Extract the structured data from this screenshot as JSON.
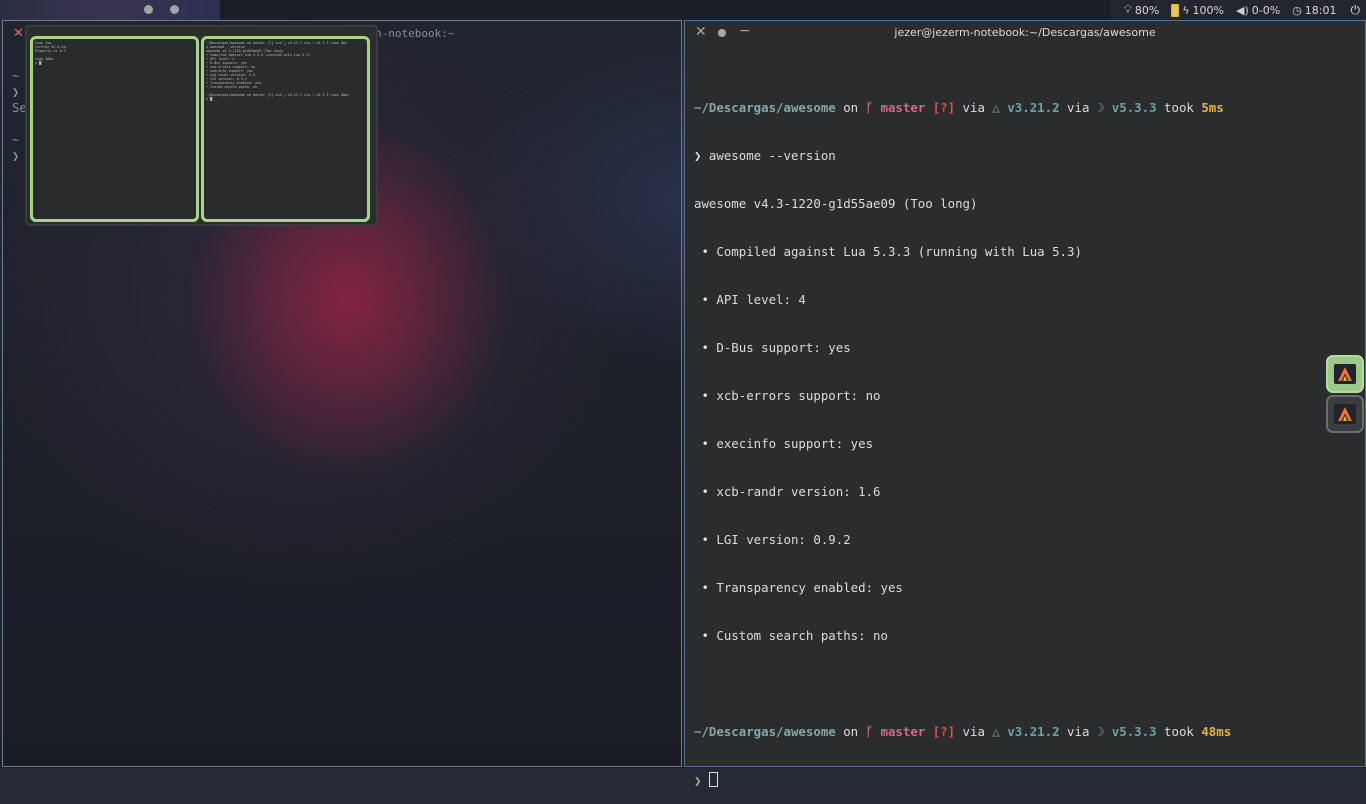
{
  "topbar": {
    "tags": [
      "tag-1",
      "tag-2",
      "tag-3",
      "tag-4",
      "tag-5",
      "tag-6",
      "tag-7"
    ],
    "status": {
      "brightness": "80%",
      "battery": "100%",
      "volume": "0-0%",
      "clock": "18:01"
    }
  },
  "left_window": {
    "title_fragment": "n-notebook:~",
    "ghost_lines": [
      "~",
      "❯",
      "Se",
      "~",
      "❯"
    ]
  },
  "switcher": {
    "thumb1_lines": [
      "took 7ms",
      "  firefox 81.0 ba",
      "  Property is 0.2",
      "",
      "took 48ms",
      "❯ █"
    ],
    "thumb2_lines": [
      "~/Descargas/awesome on  master [?] via △ v3.21.2 via ☽ v5.3.3 took 5ms",
      "❯ awesome --version",
      "awesome v4.3-1220-g1d55ae09 (Too long)",
      " • Compiled against Lua 5.3.3 (running with Lua 5.3)",
      " • API level: 4",
      " • D-Bus support: yes",
      " • xcb-errors support: no",
      " • execinfo support: yes",
      " • xcb-randr version: 1.6",
      " • LGI version: 0.9.2",
      " • Transparency enabled: yes",
      " • Custom search paths: no",
      "",
      "~/Descargas/awesome on  master [?] via △ v3.21.2 via ☽ v5.3.3 took 48ms",
      "❯ █"
    ]
  },
  "terminal": {
    "title": "jezer@jezerm-notebook:~/Descargas/awesome",
    "prompt1": {
      "path": "~/Descargas/awesome",
      "on": " on ",
      "branch_icon": "ᚴ",
      "branch": " master",
      "status": " [?]",
      "via1": " via ",
      "cmake_icon": "△",
      "cmake_ver": " v3.21.2",
      "via2": " via ",
      "lua_icon": "☽",
      "lua_ver": " v5.3.3",
      "took": " took ",
      "duration": "5ms"
    },
    "command_line": "❯ awesome --version",
    "output": [
      "awesome v4.3-1220-g1d55ae09 (Too long)",
      " • Compiled against Lua 5.3.3 (running with Lua 5.3)",
      " • API level: 4",
      " • D-Bus support: yes",
      " • xcb-errors support: no",
      " • execinfo support: yes",
      " • xcb-randr version: 1.6",
      " • LGI version: 0.9.2",
      " • Transparency enabled: yes",
      " • Custom search paths: no"
    ],
    "prompt2": {
      "path": "~/Descargas/awesome",
      "on": " on ",
      "branch_icon": "ᚴ",
      "branch": " master",
      "status": " [?]",
      "via1": " via ",
      "cmake_icon": "△",
      "cmake_ver": " v3.21.2",
      "via2": " via ",
      "lua_icon": "☽",
      "lua_ver": " v5.3.3",
      "took": " took ",
      "duration": "48ms"
    },
    "prompt_symbol": "❯ "
  },
  "dock": {
    "items": [
      "alacritty-icon",
      "alacritty-icon"
    ]
  },
  "colors": {
    "accent_green": "#a8d38a",
    "path": "#85a7a8",
    "branch": "#cf6a8f",
    "duration": "#e5b33d"
  }
}
